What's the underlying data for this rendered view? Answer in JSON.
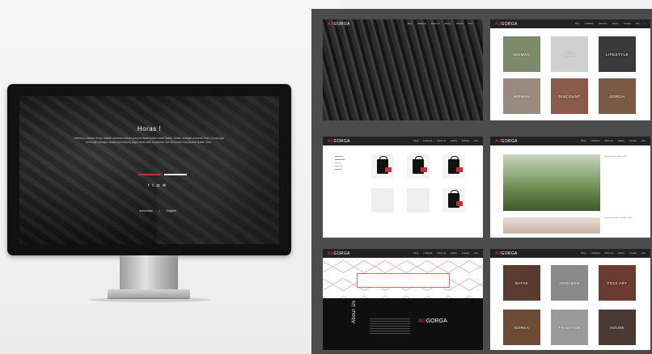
{
  "monitor": {
    "title": "Horas !",
    "description": "Yaktanya, bahwa Gorga adalah ornamen ukiran yang terdapat pada rumah Batak. Selain sebagai ornamen hias, Gorga juga berfungsi sebagai sarana pendukung daya hidup atau keyakinan dan kekuatan masyarakat Batak Toba.",
    "lang_indonesia": "Indonesia",
    "lang_separator": "|",
    "lang_english": "English",
    "accent_red": "#c9323a"
  },
  "site": {
    "logo_red": "AU",
    "logo_rest": "GORGA",
    "nav": [
      "Shop",
      "Lookbook",
      "About Us",
      "History",
      "Contact",
      "Cart"
    ]
  },
  "shop_tiles": [
    "WOMAN",
    "MEN",
    "LIFESTYLE",
    "WOMAN",
    "DISCOUNT",
    "GORGA"
  ],
  "lookbook": {
    "caption1": "Collection by Elise Mei - 2016",
    "caption2": "Collection by Batak Tribe Belt - 2016"
  },
  "about": {
    "heading": "About Us",
    "logo_red": "AU",
    "logo_rest": "GORGA"
  },
  "history_tiles": [
    "BATAK",
    "ORNAMEN",
    "FOLK ART",
    "GORGA",
    "TRADITION",
    "HOUSE"
  ]
}
